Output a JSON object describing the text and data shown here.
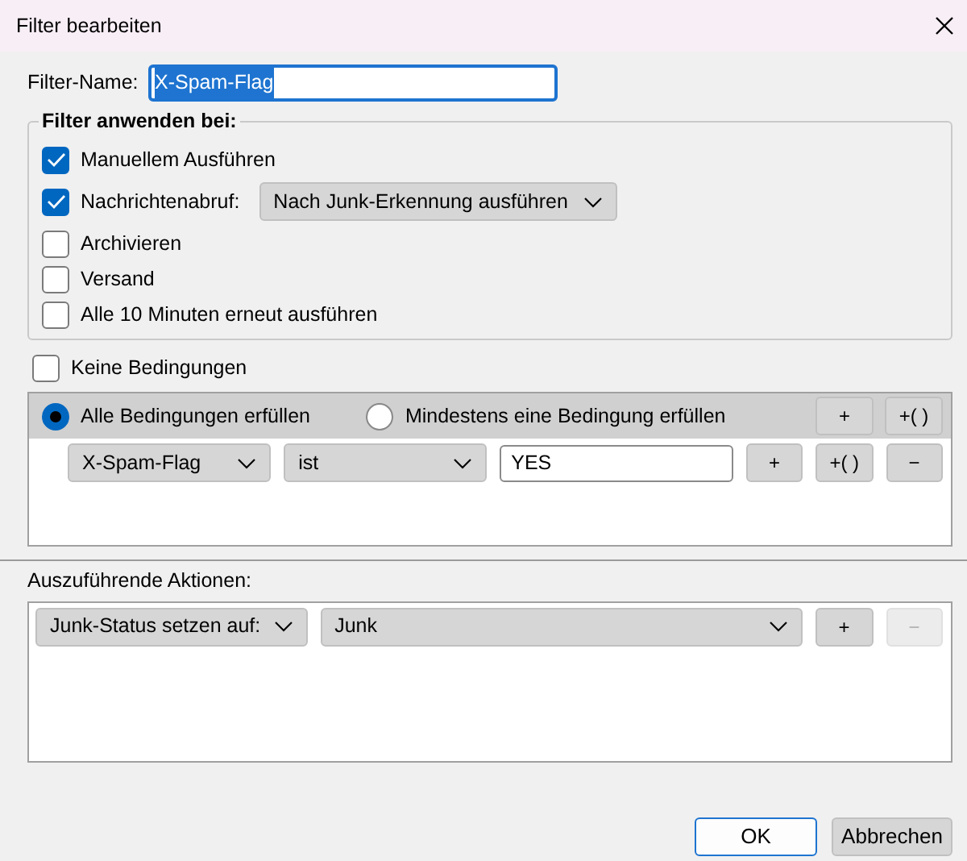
{
  "window": {
    "title": "Filter bearbeiten"
  },
  "filter_name": {
    "label": "Filter-Name:",
    "value": "X-Spam-Flag",
    "text_selected": true
  },
  "apply_on": {
    "legend": "Filter anwenden bei:",
    "options": [
      {
        "label": "Manuellem Ausführen",
        "checked": true
      },
      {
        "label": "Nachrichtenabruf:",
        "checked": true,
        "dropdown": "Nach Junk-Erkennung ausführen"
      },
      {
        "label": "Archivieren",
        "checked": false
      },
      {
        "label": "Versand",
        "checked": false
      },
      {
        "label": "Alle 10 Minuten erneut ausführen",
        "checked": false
      }
    ]
  },
  "conditions": {
    "none": {
      "label": "Keine Bedingungen",
      "checked": false
    },
    "match": [
      {
        "label": "Alle Bedingungen erfüllen",
        "selected": true
      },
      {
        "label": "Mindestens eine Bedingung erfüllen",
        "selected": false
      }
    ],
    "header_buttons": [
      "+",
      "+( )"
    ],
    "rows": [
      {
        "field": "X-Spam-Flag",
        "operator": "ist",
        "value": "YES",
        "buttons": [
          "+",
          "+( )",
          "−"
        ]
      }
    ]
  },
  "actions": {
    "label": "Auszuführende Aktionen:",
    "rows": [
      {
        "action": "Junk-Status setzen auf:",
        "value": "Junk",
        "buttons": [
          {
            "label": "+",
            "disabled": false
          },
          {
            "label": "−",
            "disabled": true
          }
        ]
      }
    ]
  },
  "footer_buttons": [
    {
      "label": "OK",
      "default": true
    },
    {
      "label": "Abbrechen",
      "default": false
    }
  ]
}
